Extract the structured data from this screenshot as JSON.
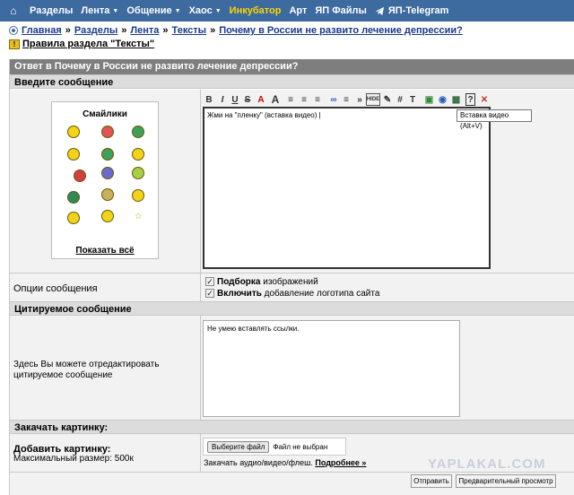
{
  "nav": {
    "home_icon": "home-icon",
    "items": [
      {
        "label": "Разделы",
        "caret": false,
        "highlight": false
      },
      {
        "label": "Лента",
        "caret": true,
        "highlight": false
      },
      {
        "label": "Общение",
        "caret": true,
        "highlight": false
      },
      {
        "label": "Хаос",
        "caret": true,
        "highlight": false
      },
      {
        "label": "Инкубатор",
        "caret": false,
        "highlight": true
      },
      {
        "label": "Арт",
        "caret": false,
        "highlight": false
      },
      {
        "label": "ЯП Файлы",
        "caret": false,
        "highlight": false
      },
      {
        "label": "ЯП-Telegram",
        "caret": false,
        "highlight": false
      }
    ],
    "bg_color": "#3d6a9f",
    "highlight_color": "#ffd700"
  },
  "breadcrumb": {
    "items": [
      "Главная",
      "Разделы",
      "Лента",
      "Тексты",
      "Почему в России не развито лечение депрессии?"
    ],
    "separator": "»"
  },
  "rules_link": "Правила раздела \"Тексты\"",
  "form": {
    "header": "Ответ в Почему в России не развито лечение депрессии?",
    "section_message": "Введите сообщение",
    "smilies_title": "Смайлики",
    "smilies_show_all": "Показать всё",
    "toolbar": [
      "B",
      "I",
      "U",
      "S",
      "A",
      "A",
      "≡",
      "≡",
      "≡",
      "∞",
      "≡",
      "»",
      "HIDE",
      "✎",
      "#",
      "T",
      "▣",
      "◉",
      "▦",
      "?",
      "✕"
    ],
    "message_text": "Жми на \"пленку\" (вставка видео) |",
    "tooltip": "Вставка видео (Alt+V)",
    "options_label": "Опции сообщения",
    "option1_bold": "Подборка",
    "option1_rest": "изображений",
    "option2_bold": "Включить",
    "option2_rest": "добавление логотипа сайта",
    "section_quote": "Цитируемое сообщение",
    "quote_label": "Здесь Вы можете отредактировать цитируемое сообщение",
    "quote_text": "Не умею вставлять ссылки.",
    "section_upload": "Закачать картинку:",
    "upload_label": "Добавить картинку:",
    "upload_max": "Максимальный размер: 500к",
    "file_button": "Выберите файл",
    "file_status": "Файл не выбран",
    "media_text": "Закачать аудио/видео/флеш.",
    "media_more": "Подробнее »",
    "send_button": "Отправить",
    "preview_button": "Предварительный просмотр"
  },
  "watermark": "YAPLAKAL.COM"
}
